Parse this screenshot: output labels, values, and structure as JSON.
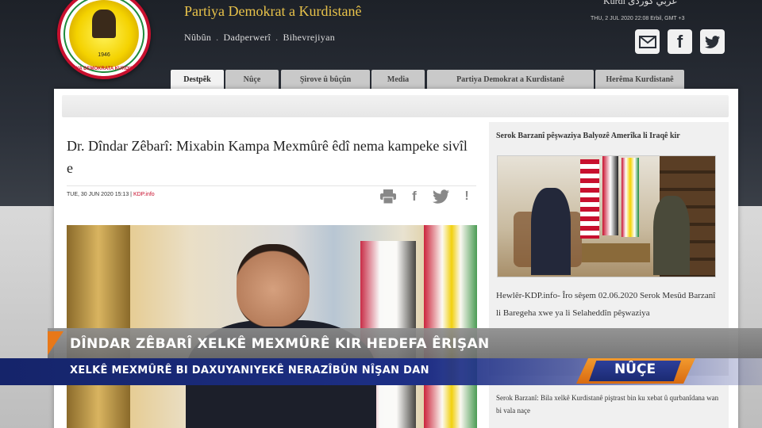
{
  "header": {
    "site_title": "Partiya Demokrat a Kurdistanê",
    "nav": [
      "Nûbûn",
      "Dadperwerî",
      "Bihevrejiyan"
    ],
    "languages": "Kurdî  عربي  کوردی",
    "date": "THU, 2 JUL 2020 22:08 Erbil, GMT +3",
    "logo": {
      "year": "1946",
      "text": "PARTIYA DEMOKRATA KURDISTANÊ"
    }
  },
  "tabs": [
    {
      "label": "Destpêk",
      "active": true
    },
    {
      "label": "Nûçe",
      "active": false
    },
    {
      "label": "Şirove û bûçûn",
      "active": false
    },
    {
      "label": "Media",
      "active": false
    },
    {
      "label": "Partiya Demokrat a Kurdistanê",
      "active": false
    },
    {
      "label": "Herêma Kurdistanê",
      "active": false
    }
  ],
  "article": {
    "title": "Dr. Dîndar Zêbarî: Mixabin Kampa Mexmûrê êdî nema kampeke sivîl e",
    "date": "TUE, 30 JUN 2020 15:13",
    "separator": "|",
    "source": "KDP.info",
    "tools": [
      "print-icon",
      "facebook-icon",
      "twitter-icon",
      "report-icon"
    ]
  },
  "sidebar": {
    "headline": "Serok Barzanî pêşwaziya Balyozê Amerîka li Iraqê kir",
    "excerpt": "Hewlêr-KDP.info- Îro sêşem 02.06.2020 Serok Mesûd Barzanî li Baregeha xwe ya li Selaheddîn pêşwaziya",
    "second_headline": "Serok Barzanî: Bila xelkê Kurdistanê piştrast bin ku xebat û qurbanîdana wan bi vala naçe"
  },
  "lower_third": {
    "headline": "DÎNDAR ZÊBARÎ XELKÊ MEXMÛRÊ KIR HEDEFA ÊRIŞAN",
    "subline": "XELKÊ MEXMÛRÊ BI DAXUYANIYEKÊ NERAZÎBÛN NÎŞAN DAN",
    "badge": "NÛÇE"
  },
  "colors": {
    "accent_orange": "#e87818",
    "ticker_blue": "#1d2f86",
    "title_gold": "#e8c24a",
    "kdp_red": "#c8102e"
  }
}
